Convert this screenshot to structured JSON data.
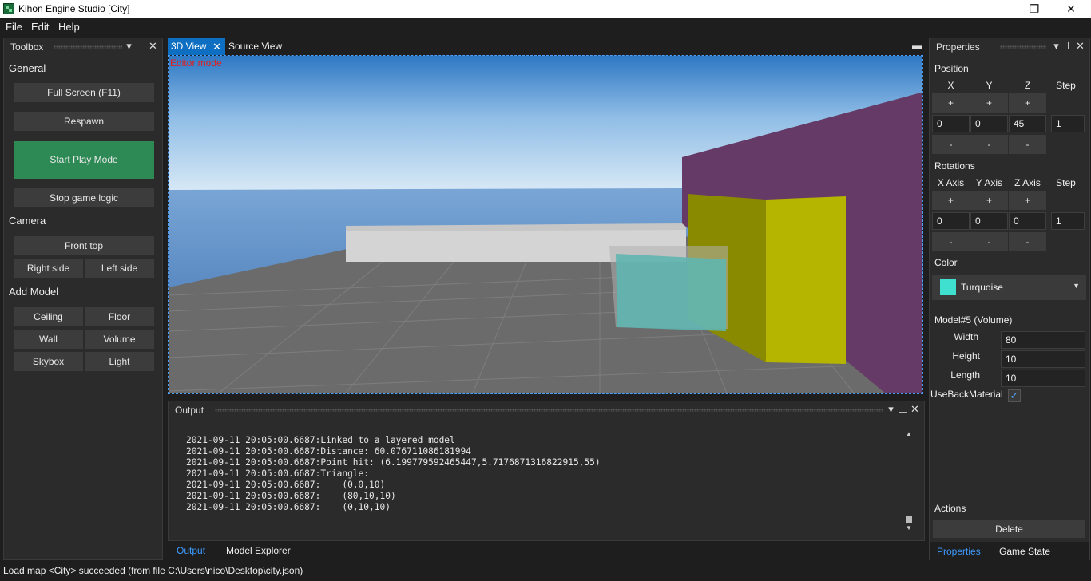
{
  "window": {
    "title": "Kihon Engine Studio [City]",
    "minimize": "—",
    "restore": "❐",
    "close": "✕"
  },
  "menu": {
    "items": [
      "File",
      "Edit",
      "Help"
    ]
  },
  "toolbox": {
    "title": "Toolbox",
    "general": {
      "label": "General",
      "full_screen": "Full Screen (F11)",
      "respawn": "Respawn",
      "start_play": "Start Play Mode",
      "stop_logic": "Stop game logic"
    },
    "camera": {
      "label": "Camera",
      "front_top": "Front top",
      "right_side": "Right side",
      "left_side": "Left side"
    },
    "add_model": {
      "label": "Add Model",
      "ceiling": "Ceiling",
      "floor": "Floor",
      "wall": "Wall",
      "volume": "Volume",
      "skybox": "Skybox",
      "light": "Light"
    },
    "start_play_color": "#2e8a55"
  },
  "document": {
    "tabs": [
      {
        "label": "3D View",
        "active": true
      },
      {
        "label": "Source View",
        "active": false
      }
    ],
    "editor_mode": "Editor mode",
    "accent": "#0e6fc2"
  },
  "output": {
    "title": "Output",
    "lines": [
      "2021-09-11 20:05:00.6687:Linked to a layered model",
      "2021-09-11 20:05:00.6687:Distance: 60.076711086181994",
      "2021-09-11 20:05:00.6687:Point hit: (6.199779592465447,5.7176871316822915,55)",
      "2021-09-11 20:05:00.6687:Triangle:",
      "2021-09-11 20:05:00.6687:    (0,0,10)",
      "2021-09-11 20:05:00.6687:    (80,10,10)",
      "2021-09-11 20:05:00.6687:    (0,10,10)"
    ],
    "tabs": [
      "Output",
      "Model Explorer"
    ]
  },
  "properties": {
    "title": "Properties",
    "position": {
      "label": "Position",
      "cols": [
        "X",
        "Y",
        "Z",
        "Step"
      ],
      "values": [
        "0",
        "0",
        "45",
        "1"
      ]
    },
    "rotations": {
      "label": "Rotations",
      "cols": [
        "X Axis",
        "Y Axis",
        "Z Axis",
        "Step"
      ],
      "values": [
        "0",
        "0",
        "0",
        "1"
      ]
    },
    "plus": "+",
    "minus": "-",
    "color": {
      "label": "Color",
      "value": "Turquoise",
      "swatch": "#40e0d0"
    },
    "model": {
      "label": "Model#5 (Volume)",
      "width_label": "Width",
      "width": "80",
      "height_label": "Height",
      "height": "10",
      "length_label": "Length",
      "length": "10",
      "back_material_label": "UseBackMaterial",
      "back_material_checked": true
    },
    "actions": {
      "label": "Actions",
      "delete": "Delete"
    },
    "tabs": [
      "Properties",
      "Game State"
    ]
  },
  "status": {
    "text": "Load map <City> succeeded (from file C:\\Users\\nico\\Desktop\\city.json)"
  },
  "colors": {
    "wall_purple": "#663a66",
    "block_yellow": "#b5b500",
    "block_turquoise": "#5fb5b0",
    "floor_gray": "#6b6b6b"
  }
}
